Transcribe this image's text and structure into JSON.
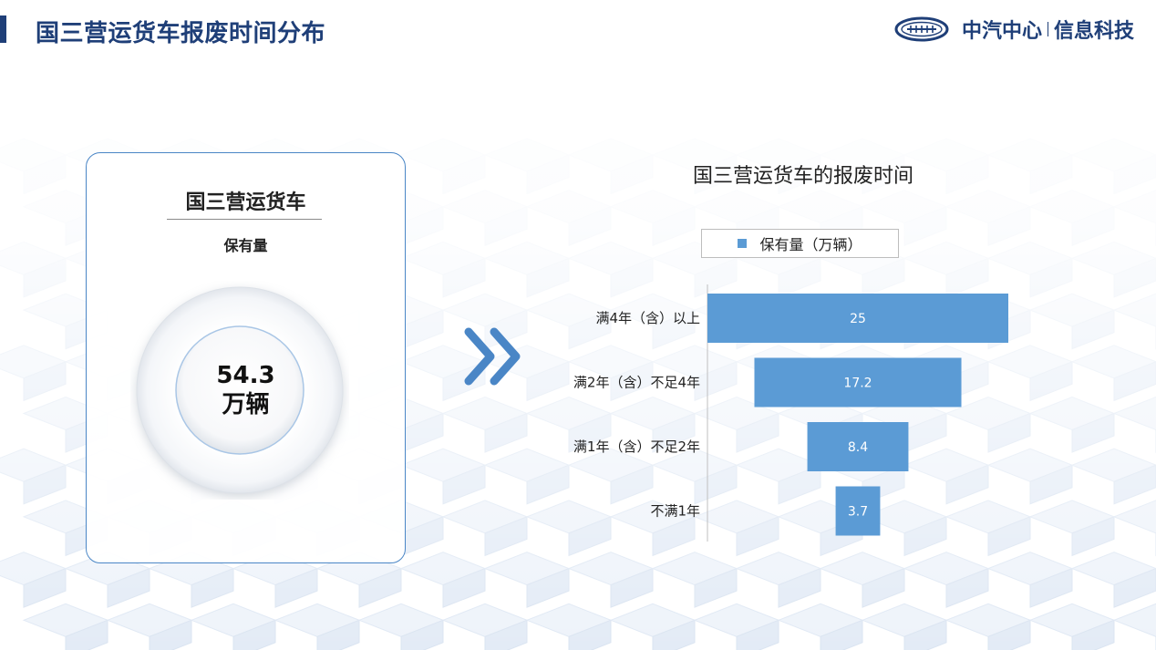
{
  "header": {
    "title": "国三营运货车报废时间分布",
    "brand_name": "中汽中心",
    "brand_sub": "信息科技",
    "brand_color": "#1f3f78"
  },
  "card": {
    "title": "国三营运货车",
    "subtitle": "保有量",
    "value": "54.3",
    "unit": "万辆"
  },
  "chart_data": {
    "type": "bar",
    "orientation": "horizontal",
    "layout": "funnel",
    "title": "国三营运货车的报废时间",
    "categories": [
      "满4年（含）以上",
      "满2年（含）不足4年",
      "满1年（含）不足2年",
      "不满1年"
    ],
    "series": [
      {
        "name": "保有量（万辆）",
        "values": [
          25,
          17.2,
          8.4,
          3.7
        ],
        "color": "#5b9bd5"
      }
    ],
    "data_labels": [
      "25",
      "17.2",
      "8.4",
      "3.7"
    ],
    "legend_position": "top",
    "grid": false
  }
}
